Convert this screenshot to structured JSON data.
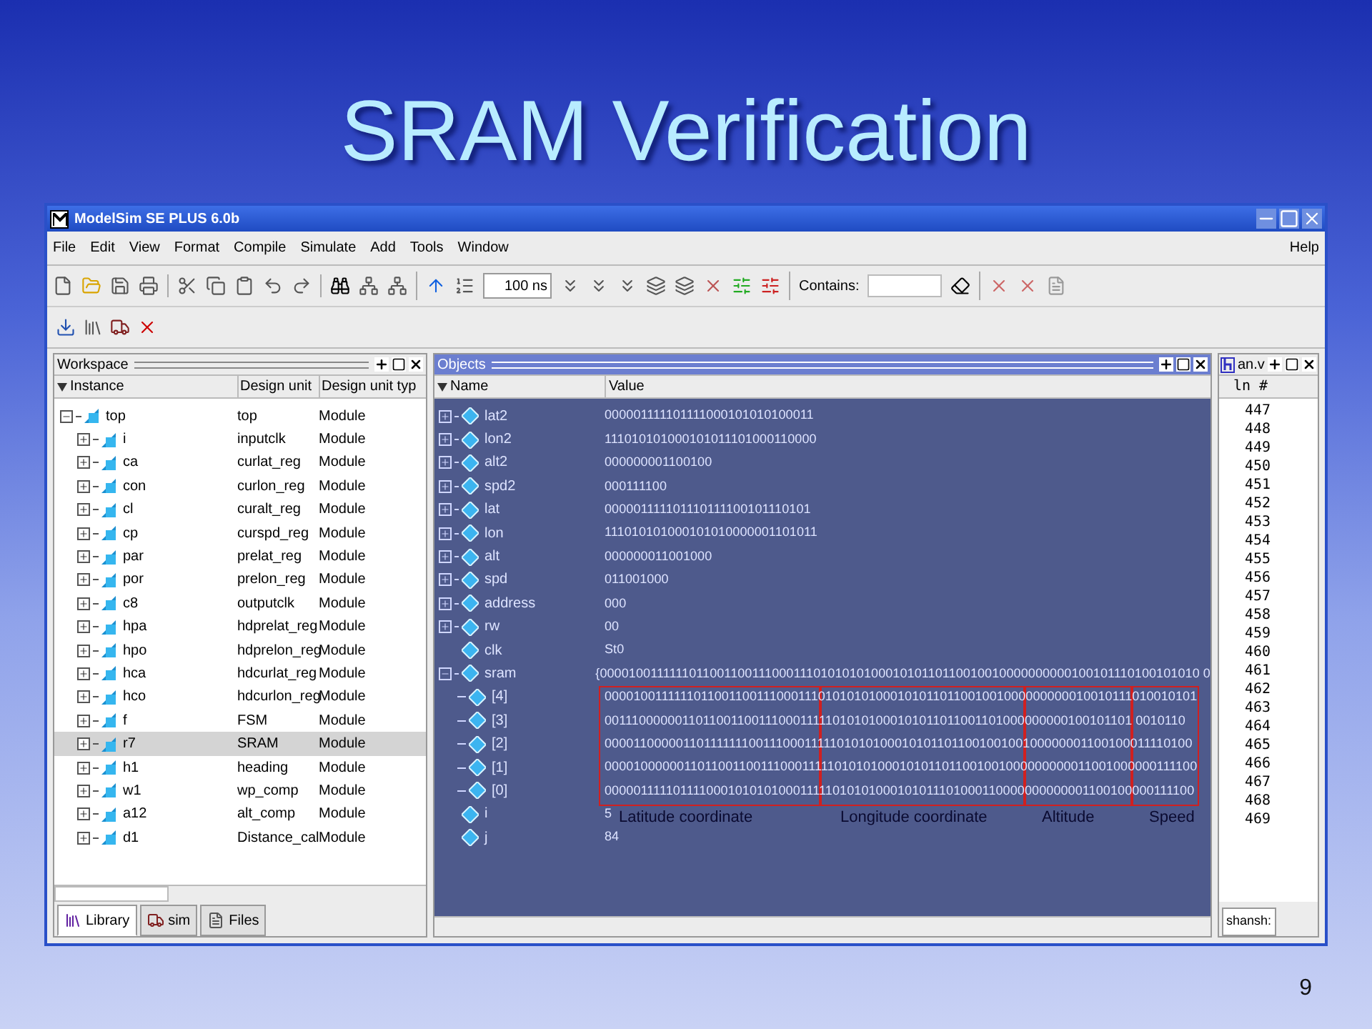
{
  "slide": {
    "title": "SRAM Verification",
    "page_number": "9"
  },
  "window": {
    "title": "ModelSim SE PLUS 6.0b"
  },
  "menu": [
    "File",
    "Edit",
    "View",
    "Format",
    "Compile",
    "Simulate",
    "Add",
    "Tools",
    "Window"
  ],
  "help_menu": "Help",
  "toolbar": {
    "run_length": "100 ns",
    "contains_label": "Contains:"
  },
  "workspace": {
    "title": "Workspace",
    "columns": [
      "Instance",
      "Design unit",
      "Design unit typ"
    ],
    "tree": [
      {
        "name": "top",
        "unit": "top",
        "type": "Module",
        "expanded": true,
        "selected": false,
        "children": [
          {
            "name": "i",
            "unit": "inputclk",
            "type": "Module",
            "expanded": false,
            "selected": false
          },
          {
            "name": "ca",
            "unit": "curlat_reg",
            "type": "Module",
            "expanded": false,
            "selected": false
          },
          {
            "name": "con",
            "unit": "curlon_reg",
            "type": "Module",
            "expanded": false,
            "selected": false
          },
          {
            "name": "cl",
            "unit": "curalt_reg",
            "type": "Module",
            "expanded": false,
            "selected": false
          },
          {
            "name": "cp",
            "unit": "curspd_reg",
            "type": "Module",
            "expanded": false,
            "selected": false
          },
          {
            "name": "par",
            "unit": "prelat_reg",
            "type": "Module",
            "expanded": false,
            "selected": false
          },
          {
            "name": "por",
            "unit": "prelon_reg",
            "type": "Module",
            "expanded": false,
            "selected": false
          },
          {
            "name": "c8",
            "unit": "outputclk",
            "type": "Module",
            "expanded": false,
            "selected": false
          },
          {
            "name": "hpa",
            "unit": "hdprelat_reg",
            "type": "Module",
            "expanded": false,
            "selected": false
          },
          {
            "name": "hpo",
            "unit": "hdprelon_reg",
            "type": "Module",
            "expanded": false,
            "selected": false
          },
          {
            "name": "hca",
            "unit": "hdcurlat_reg",
            "type": "Module",
            "expanded": false,
            "selected": false
          },
          {
            "name": "hco",
            "unit": "hdcurlon_reg",
            "type": "Module",
            "expanded": false,
            "selected": false
          },
          {
            "name": "f",
            "unit": "FSM",
            "type": "Module",
            "expanded": false,
            "selected": false
          },
          {
            "name": "r7",
            "unit": "SRAM",
            "type": "Module",
            "expanded": false,
            "selected": true
          },
          {
            "name": "h1",
            "unit": "heading",
            "type": "Module",
            "expanded": false,
            "selected": false
          },
          {
            "name": "w1",
            "unit": "wp_comp",
            "type": "Module",
            "expanded": false,
            "selected": false
          },
          {
            "name": "a12",
            "unit": "alt_comp",
            "type": "Module",
            "expanded": false,
            "selected": false
          },
          {
            "name": "d1",
            "unit": "Distance_cal",
            "type": "Module",
            "expanded": false,
            "selected": false
          }
        ]
      }
    ],
    "tabs": [
      {
        "label": "Library",
        "selected": true
      },
      {
        "label": "sim",
        "selected": false
      },
      {
        "label": "Files",
        "selected": false
      }
    ]
  },
  "objects": {
    "title": "Objects",
    "columns": [
      "Name",
      "Value"
    ],
    "rows": [
      {
        "kind": "vector",
        "name": "lat2",
        "value": "000001111101111000101010100011",
        "expanded": false
      },
      {
        "kind": "vector",
        "name": "lon2",
        "value": "111010101000101011101000110000",
        "expanded": false
      },
      {
        "kind": "vector",
        "name": "alt2",
        "value": "000000001100100",
        "expanded": false
      },
      {
        "kind": "vector",
        "name": "spd2",
        "value": "000111100",
        "expanded": false
      },
      {
        "kind": "vector",
        "name": "lat",
        "value": "000001111101110111100101110101",
        "expanded": false
      },
      {
        "kind": "vector",
        "name": "lon",
        "value": "111010101000101010000001101011",
        "expanded": false
      },
      {
        "kind": "vector",
        "name": "alt",
        "value": "000000011001000",
        "expanded": false
      },
      {
        "kind": "vector",
        "name": "spd",
        "value": "011001000",
        "expanded": false
      },
      {
        "kind": "vector",
        "name": "address",
        "value": "000",
        "expanded": false
      },
      {
        "kind": "vector",
        "name": "rw",
        "value": "00",
        "expanded": false
      },
      {
        "kind": "scalar",
        "name": "clk",
        "value": "St0"
      },
      {
        "kind": "vector",
        "name": "sram",
        "value": "{0000100111111011001100111000111010101010001010110110010010000000000100101110100101010 0",
        "expanded": true,
        "children": [
          {
            "name": "[4]",
            "value": "000010011111101100110011100011101010101000101011011001001000000000010010111010010101"
          },
          {
            "name": "[3]",
            "value": "001110000001101100110011100011111010101000101011011001101000000000100101101 0010110"
          },
          {
            "name": "[2]",
            "value": "000011000001101111111001110001111101010100010101101100100100100000001100100011110100"
          },
          {
            "name": "[1]",
            "value": "000010000001101100110011100011111010101000101011011001001000000000011001000000111100"
          },
          {
            "name": "[0]",
            "value": "000001111101111000101010100011111010101000101011101000110000000000001100100000111100"
          }
        ]
      },
      {
        "kind": "scalar",
        "name": "i",
        "value": "5"
      },
      {
        "kind": "scalar",
        "name": "j",
        "value": "84"
      }
    ],
    "annotations": [
      "Latitude coordinate",
      "Longitude coordinate",
      "Altitude",
      "Speed"
    ]
  },
  "source": {
    "title": "an.v",
    "column": "ln #",
    "lines": [
      "447",
      "448",
      "449",
      "450",
      "451",
      "452",
      "453",
      "454",
      "455",
      "456",
      "457",
      "458",
      "459",
      "460",
      "461",
      "462",
      "463",
      "464",
      "465",
      "466",
      "467",
      "468",
      "469"
    ],
    "tab": "shansh:"
  }
}
